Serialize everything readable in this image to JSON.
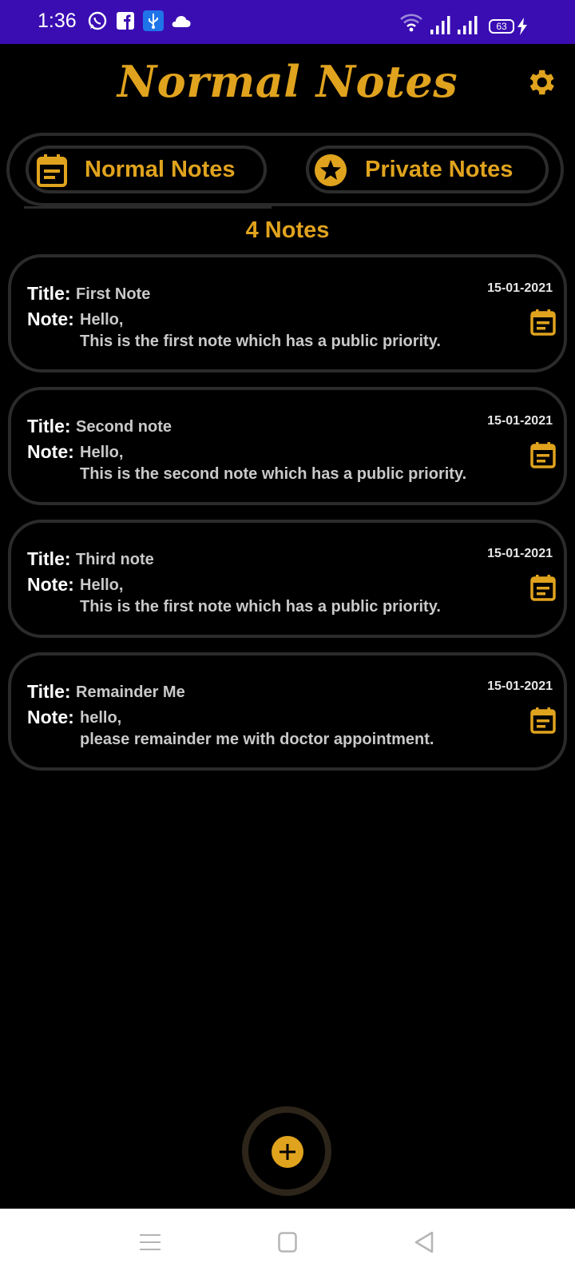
{
  "status_bar": {
    "time": "1:36",
    "battery": "63"
  },
  "app": {
    "title": "Normal Notes"
  },
  "tabs": [
    {
      "label": "Normal Notes",
      "icon": "note-calendar-icon"
    },
    {
      "label": "Private Notes",
      "icon": "star-icon"
    }
  ],
  "notes_count": "4 Notes",
  "labels": {
    "title": "Title:",
    "note": "Note:"
  },
  "notes": [
    {
      "title": "First Note",
      "line1": "Hello,",
      "line2": "This is the first note which has a public priority.",
      "date": "15-01-2021"
    },
    {
      "title": "Second note",
      "line1": "Hello,",
      "line2": "This is the second note which has a public priority.",
      "date": "15-01-2021"
    },
    {
      "title": "Third note",
      "line1": "Hello,",
      "line2": "This is the first note which has a public priority.",
      "date": "15-01-2021"
    },
    {
      "title": "Remainder Me",
      "line1": "hello,",
      "line2": "please remainder me with doctor appointment.",
      "date": "15-01-2021"
    }
  ],
  "colors": {
    "accent": "#e0a31e",
    "status_bar": "#3a0db3",
    "background": "#000000",
    "card_border": "#2b2b2b"
  }
}
